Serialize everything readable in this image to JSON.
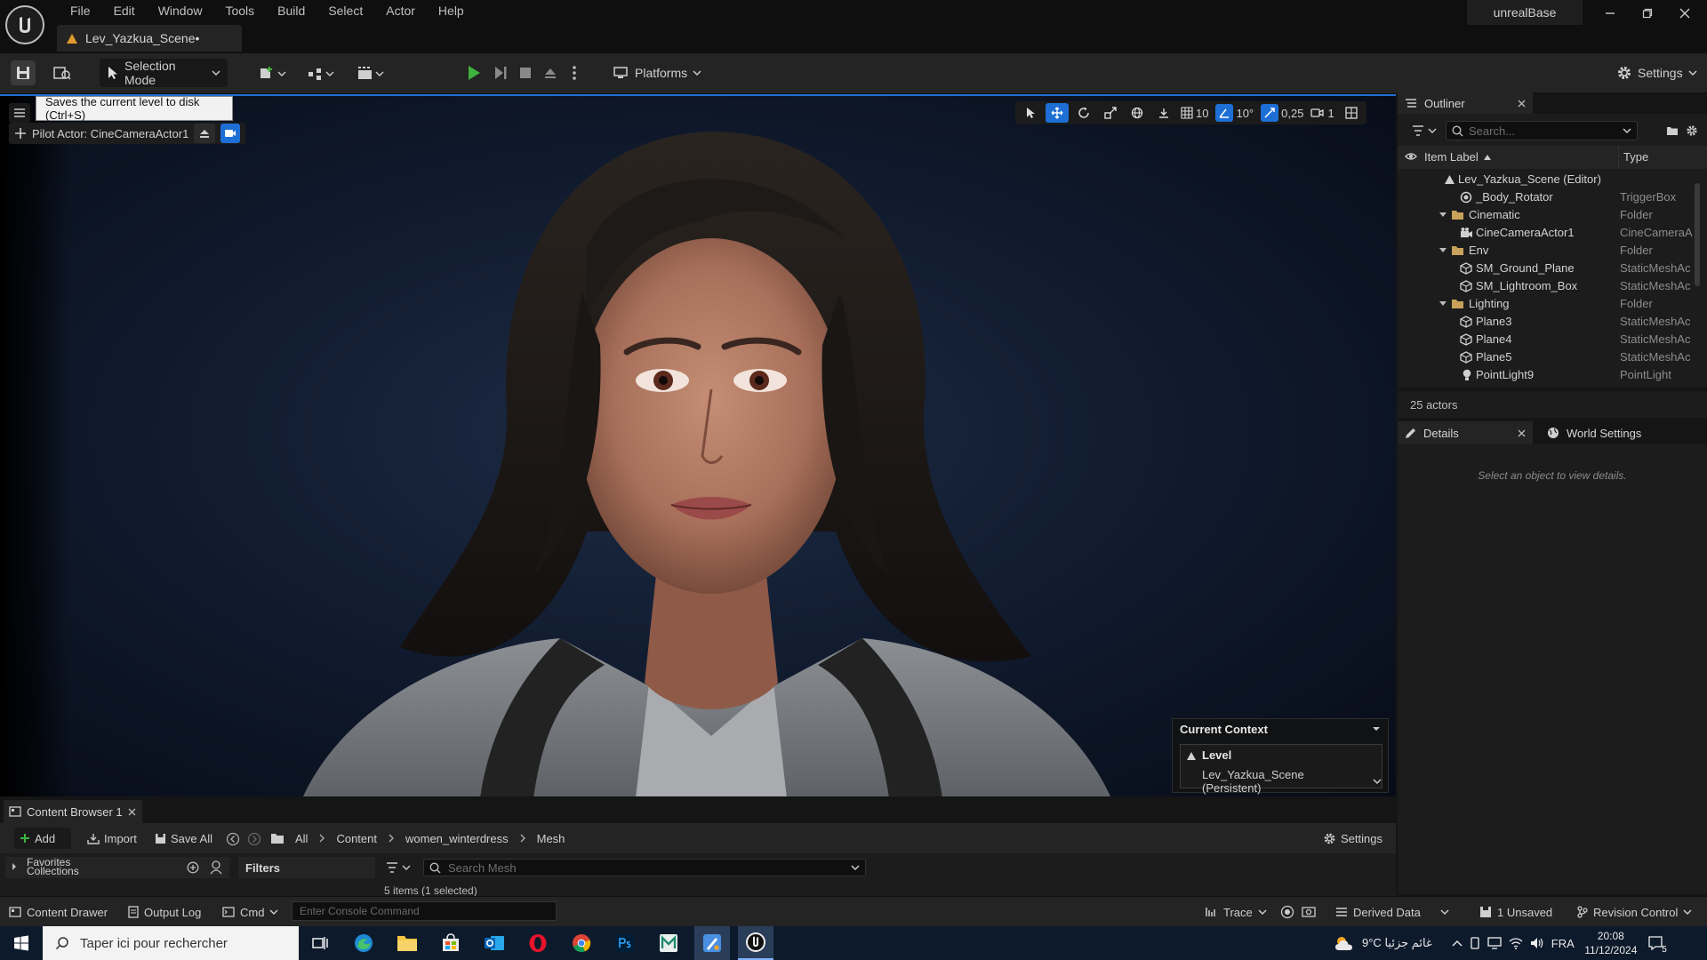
{
  "menu": {
    "items": [
      "File",
      "Edit",
      "Window",
      "Tools",
      "Build",
      "Select",
      "Actor",
      "Help"
    ],
    "level_tab": "Lev_Yazkua_Scene•",
    "project": "unrealBase"
  },
  "toolbar": {
    "selection_mode": "Selection Mode",
    "platforms": "Platforms",
    "settings": "Settings"
  },
  "viewport": {
    "tooltip": "Saves the current level to disk (Ctrl+S)",
    "pilot_actor": "Pilot Actor: CineCameraActor1",
    "grid_snap": "10",
    "rotation_snap": "10°",
    "scale_snap": "0,25",
    "camera_speed": "1",
    "context": {
      "title": "Current Context",
      "level_label": "Level",
      "level_value": "Lev_Yazkua_Scene (Persistent)"
    }
  },
  "outliner": {
    "tab": "Outliner",
    "search_placeholder": "Search...",
    "col_label": "Item Label",
    "col_type": "Type",
    "rows": [
      {
        "label": "Lev_Yazkua_Scene (Editor)",
        "type": ""
      },
      {
        "label": "_Body_Rotator",
        "type": "TriggerBox"
      },
      {
        "label": "Cinematic",
        "type": "Folder"
      },
      {
        "label": "CineCameraActor1",
        "type": "CineCameraA"
      },
      {
        "label": "Env",
        "type": "Folder"
      },
      {
        "label": "SM_Ground_Plane",
        "type": "StaticMeshAc"
      },
      {
        "label": "SM_Lightroom_Box",
        "type": "StaticMeshAc"
      },
      {
        "label": "Lighting",
        "type": "Folder"
      },
      {
        "label": "Plane3",
        "type": "StaticMeshAc"
      },
      {
        "label": "Plane4",
        "type": "StaticMeshAc"
      },
      {
        "label": "Plane5",
        "type": "StaticMeshAc"
      },
      {
        "label": "PointLight9",
        "type": "PointLight"
      }
    ],
    "count": "25 actors"
  },
  "details": {
    "tab": "Details",
    "world_tab": "World Settings",
    "empty_message": "Select an object to view details."
  },
  "content_browser": {
    "tab": "Content Browser 1",
    "add": "Add",
    "import": "Import",
    "save_all": "Save All",
    "path": [
      "All",
      "Content",
      "women_winterdress",
      "Mesh"
    ],
    "settings": "Settings",
    "favorites": "Favorites",
    "collections": "Collections",
    "filters": "Filters",
    "search_placeholder": "Search Mesh",
    "items_count": "5 items (1 selected)"
  },
  "statusbar": {
    "content_drawer": "Content Drawer",
    "output_log": "Output Log",
    "cmd": "Cmd",
    "console_placeholder": "Enter Console Command",
    "trace": "Trace",
    "derived_data": "Derived Data",
    "unsaved": "1 Unsaved",
    "revision_control": "Revision Control"
  },
  "taskbar": {
    "search_placeholder": "Taper ici pour rechercher",
    "weather": "9°C  غائم جزئيا",
    "language": "FRA",
    "time": "20:08",
    "date": "11/12/2024",
    "notifications": "5"
  },
  "colors": {
    "accent": "#1d6fd6",
    "play": "#3fb33f",
    "panel": "#242424",
    "background": "#151515"
  }
}
